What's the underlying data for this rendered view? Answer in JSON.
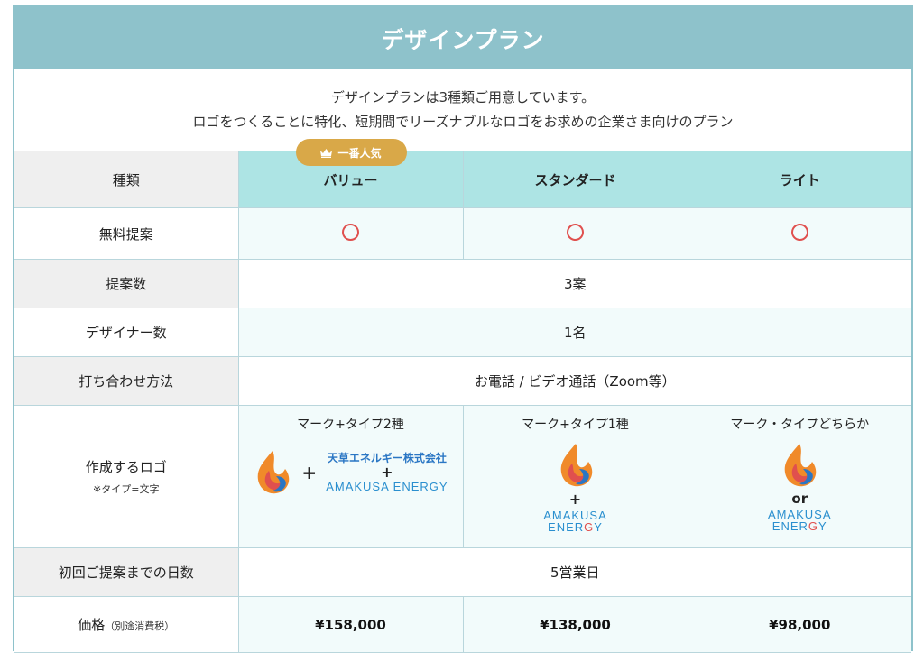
{
  "header": {
    "title": "デザインプラン"
  },
  "intro": {
    "line1": "デザインプランは3種類ご用意しています。",
    "line2": "ロゴをつくることに特化、短期間でリーズナブルなロゴをお求めの企業さま向けのプラン"
  },
  "badge": {
    "label": "一番人気",
    "icon": "crown-icon"
  },
  "columns": [
    "バリュー",
    "スタンダード",
    "ライト"
  ],
  "rows": {
    "type_label": "種類",
    "free_label": "無料提案",
    "proposals_label": "提案数",
    "proposals_value": "3案",
    "designers_label": "デザイナー数",
    "designers_value": "1名",
    "meeting_label": "打ち合わせ方法",
    "meeting_value": "お電話 / ビデオ通話（Zoom等）",
    "logo_label": "作成するロゴ",
    "logo_note": "※タイプ=文字",
    "days_label": "初回ご提案までの日数",
    "days_value": "5営業日",
    "price_label": "価格",
    "price_note": "（別途消費税）"
  },
  "logo": {
    "value_title": "マーク+タイプ2種",
    "standard_title": "マーク+タイプ1種",
    "lite_title": "マーク・タイプどちらか",
    "plus": "+",
    "or": "or",
    "brand_jp": "天草エネルギー株式会社",
    "brand_en": "AMAKUSA ENERGY",
    "brand_en_line1": "AMAKUSA",
    "brand_en_line2_a": "ENER",
    "brand_en_line2_g": "G",
    "brand_en_line2_b": "Y"
  },
  "prices": [
    "¥158,000",
    "¥138,000",
    "¥98,000"
  ],
  "colors": {
    "header_bg": "#8ec2cb",
    "column_head_bg": "#ade4e4",
    "badge_bg": "#d9a848",
    "circle": "#e0504e",
    "brand_blue": "#2a8fcf"
  }
}
